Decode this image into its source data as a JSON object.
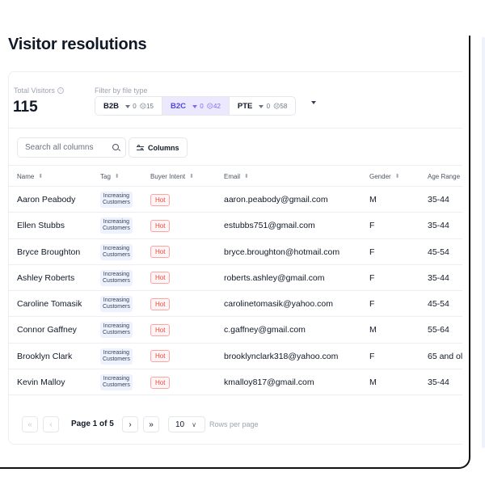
{
  "page": {
    "title": "Visitor resolutions"
  },
  "stats": {
    "total_label": "Total Visitors",
    "total_value": "115",
    "filter_label": "Filter by file type",
    "segments": [
      {
        "name": "B2B",
        "filter_count": "0",
        "user_count": "15",
        "active": false
      },
      {
        "name": "B2C",
        "filter_count": "0",
        "user_count": "42",
        "active": true
      },
      {
        "name": "PTE",
        "filter_count": "0",
        "user_count": "58",
        "active": false
      }
    ]
  },
  "toolbar": {
    "search_placeholder": "Search all columns",
    "columns_label": "Columns"
  },
  "table": {
    "headers": {
      "name": "Name",
      "tag": "Tag",
      "intent": "Buyer Intent",
      "email": "Email",
      "gender": "Gender",
      "age": "Age Range"
    },
    "rows": [
      {
        "name": "Aaron Peabody",
        "tag": "Increasing Customers",
        "intent": "Hot",
        "email": "aaron.peabody@gmail.com",
        "gender": "M",
        "age": "35-44"
      },
      {
        "name": "Ellen Stubbs",
        "tag": "Increasing Customers",
        "intent": "Hot",
        "email": "estubbs751@gmail.com",
        "gender": "F",
        "age": "35-44"
      },
      {
        "name": "Bryce Broughton",
        "tag": "Increasing Customers",
        "intent": "Hot",
        "email": "bryce.broughton@hotmail.com",
        "gender": "F",
        "age": "45-54"
      },
      {
        "name": "Ashley Roberts",
        "tag": "Increasing Customers",
        "intent": "Hot",
        "email": "roberts.ashley@gmail.com",
        "gender": "F",
        "age": "35-44"
      },
      {
        "name": "Caroline Tomasik",
        "tag": "Increasing Customers",
        "intent": "Hot",
        "email": "carolinetomasik@yahoo.com",
        "gender": "F",
        "age": "45-54"
      },
      {
        "name": "Connor Gaffney",
        "tag": "Increasing Customers",
        "intent": "Hot",
        "email": "c.gaffney@gmail.com",
        "gender": "M",
        "age": "55-64"
      },
      {
        "name": "Brooklyn Clark",
        "tag": "Increasing Customers",
        "intent": "Hot",
        "email": "brooklynclark318@yahoo.com",
        "gender": "F",
        "age": "65 and ol"
      },
      {
        "name": "Kevin Malloy",
        "tag": "Increasing Customers",
        "intent": "Hot",
        "email": "kmalloy817@gmail.com",
        "gender": "M",
        "age": "35-44"
      }
    ]
  },
  "pagination": {
    "first": "«",
    "prev": "‹",
    "next": "›",
    "last": "»",
    "page_info": "Page 1 of 5",
    "rows_per_page_value": "10",
    "rows_per_page_label": "Rows per page"
  },
  "colors": {
    "accent": "#4f46e5",
    "active_segment_bg": "#ece8fd",
    "hot": "#ef4444",
    "tag_bg": "#eef2ff"
  },
  "icons": [
    "info-icon",
    "filter-icon",
    "user-icon",
    "chevron-down-icon",
    "search-icon",
    "sliders-icon",
    "sort-icon"
  ]
}
